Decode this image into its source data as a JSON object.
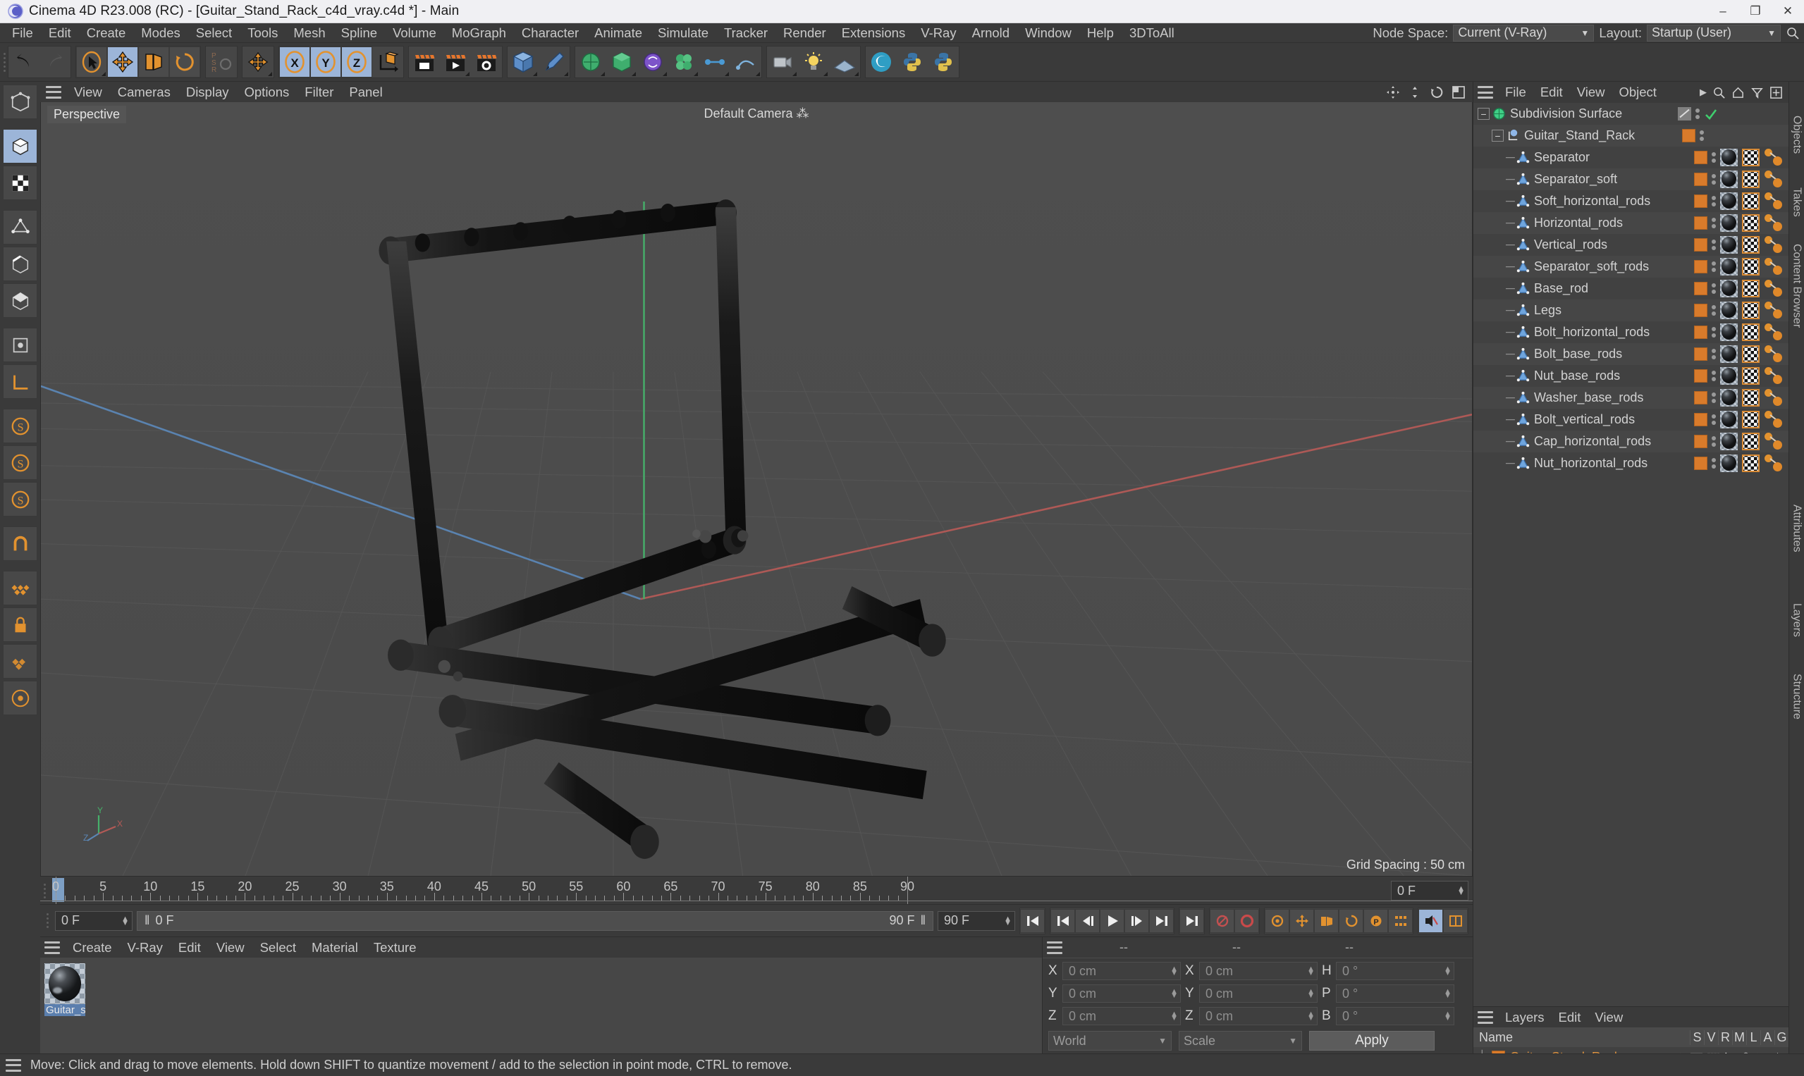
{
  "titlebar": {
    "title": "Cinema 4D R23.008 (RC) - [Guitar_Stand_Rack_c4d_vray.c4d *] - Main",
    "minimize": "–",
    "maximize": "❐",
    "close": "✕"
  },
  "menubar": {
    "items": [
      "File",
      "Edit",
      "Create",
      "Modes",
      "Select",
      "Tools",
      "Mesh",
      "Spline",
      "Volume",
      "MoGraph",
      "Character",
      "Animate",
      "Simulate",
      "Tracker",
      "Render",
      "Extensions",
      "V-Ray",
      "Arnold",
      "Window",
      "Help",
      "3DToAll"
    ],
    "node_space_label": "Node Space:",
    "node_space_value": "Current (V-Ray)",
    "layout_label": "Layout:",
    "layout_value": "Startup (User)"
  },
  "viewport": {
    "menu": [
      "View",
      "Cameras",
      "Display",
      "Options",
      "Filter",
      "Panel"
    ],
    "label": "Perspective",
    "camera": "Default Camera",
    "grid_spacing": "Grid Spacing : 50 cm",
    "axis_x": "X",
    "axis_y": "Y",
    "axis_z": "Z"
  },
  "timeline": {
    "ticks": [
      {
        "label": "0",
        "value": 0
      },
      {
        "label": "5",
        "value": 5
      },
      {
        "label": "10",
        "value": 10
      },
      {
        "label": "15",
        "value": 15
      },
      {
        "label": "20",
        "value": 20
      },
      {
        "label": "25",
        "value": 25
      },
      {
        "label": "30",
        "value": 30
      },
      {
        "label": "35",
        "value": 35
      },
      {
        "label": "40",
        "value": 40
      },
      {
        "label": "45",
        "value": 45
      },
      {
        "label": "50",
        "value": 50
      },
      {
        "label": "55",
        "value": 55
      },
      {
        "label": "60",
        "value": 60
      },
      {
        "label": "65",
        "value": 65
      },
      {
        "label": "70",
        "value": 70
      },
      {
        "label": "75",
        "value": 75
      },
      {
        "label": "80",
        "value": 80
      },
      {
        "label": "85",
        "value": 85
      },
      {
        "label": "90",
        "value": 90
      }
    ],
    "current_frame": "0 F",
    "current_frame2": "0 F",
    "range_start": "0 F",
    "range_end": "90 F",
    "end_field": "90 F",
    "frame_field_right": "0 F",
    "min_frame": 0,
    "max_frame": 90
  },
  "material_manager": {
    "menu": [
      "Create",
      "V-Ray",
      "Edit",
      "View",
      "Select",
      "Material",
      "Texture"
    ],
    "materials": [
      {
        "name": "Guitar_st"
      }
    ]
  },
  "coordinates": {
    "header": [
      "--",
      "--",
      "--"
    ],
    "rows": [
      {
        "l1": "X",
        "v1": "0 cm",
        "l2": "X",
        "v2": "0 cm",
        "l3": "H",
        "v3": "0 °"
      },
      {
        "l1": "Y",
        "v1": "0 cm",
        "l2": "Y",
        "v2": "0 cm",
        "l3": "P",
        "v3": "0 °"
      },
      {
        "l1": "Z",
        "v1": "0 cm",
        "l2": "Z",
        "v2": "0 cm",
        "l3": "B",
        "v3": "0 °"
      }
    ],
    "system": "World",
    "mode": "Scale",
    "apply": "Apply"
  },
  "statusbar": {
    "message": "Move: Click and drag to move elements. Hold down SHIFT to quantize movement / add to the selection in point mode, CTRL to remove."
  },
  "object_manager": {
    "menu": [
      "File",
      "Edit",
      "View",
      "Object"
    ],
    "rows": [
      {
        "name": "Subdivision Surface",
        "depth": 0,
        "type": "generator",
        "expander": "−",
        "tags": "subdiv"
      },
      {
        "name": "Guitar_Stand_Rack",
        "depth": 1,
        "type": "null",
        "expander": "−",
        "tags": "layer"
      },
      {
        "name": "Separator",
        "depth": 2,
        "type": "polygon",
        "expander": "",
        "tags": "full"
      },
      {
        "name": "Separator_soft",
        "depth": 2,
        "type": "polygon",
        "expander": "",
        "tags": "full"
      },
      {
        "name": "Soft_horizontal_rods",
        "depth": 2,
        "type": "polygon",
        "expander": "",
        "tags": "full"
      },
      {
        "name": "Horizontal_rods",
        "depth": 2,
        "type": "polygon",
        "expander": "",
        "tags": "full"
      },
      {
        "name": "Vertical_rods",
        "depth": 2,
        "type": "polygon",
        "expander": "",
        "tags": "full"
      },
      {
        "name": "Separator_soft_rods",
        "depth": 2,
        "type": "polygon",
        "expander": "",
        "tags": "full"
      },
      {
        "name": "Base_rod",
        "depth": 2,
        "type": "polygon",
        "expander": "",
        "tags": "full"
      },
      {
        "name": "Legs",
        "depth": 2,
        "type": "polygon",
        "expander": "",
        "tags": "full"
      },
      {
        "name": "Bolt_horizontal_rods",
        "depth": 2,
        "type": "polygon",
        "expander": "",
        "tags": "full"
      },
      {
        "name": "Bolt_base_rods",
        "depth": 2,
        "type": "polygon",
        "expander": "",
        "tags": "full"
      },
      {
        "name": "Nut_base_rods",
        "depth": 2,
        "type": "polygon",
        "expander": "",
        "tags": "full"
      },
      {
        "name": "Washer_base_rods",
        "depth": 2,
        "type": "polygon",
        "expander": "",
        "tags": "full"
      },
      {
        "name": "Bolt_vertical_rods",
        "depth": 2,
        "type": "polygon",
        "expander": "",
        "tags": "full"
      },
      {
        "name": "Cap_horizontal_rods",
        "depth": 2,
        "type": "polygon",
        "expander": "",
        "tags": "full"
      },
      {
        "name": "Nut_horizontal_rods",
        "depth": 2,
        "type": "polygon",
        "expander": "",
        "tags": "full"
      }
    ]
  },
  "layer_manager": {
    "menu": [
      "Layers",
      "Edit",
      "View"
    ],
    "columns": [
      "Name",
      "S",
      "V",
      "R",
      "M",
      "L",
      "A",
      "G"
    ],
    "rows": [
      {
        "name": "Guitar_Stand_Rack",
        "color": "#d97b2b"
      }
    ]
  },
  "docktabs": {
    "right": [
      "Objects",
      "Takes",
      "Content Browser"
    ],
    "right_lower": [
      "Attributes",
      "Layers",
      "Structure"
    ]
  },
  "colors": {
    "accent_orange": "#d97b2b",
    "selection_blue": "#9cb5d8",
    "panel_bg": "#3a3a3a",
    "viewport_bg": "#4a4a4a",
    "axis_x": "#c0504d",
    "axis_y": "#3fa34d",
    "axis_z": "#4a7ebb"
  }
}
